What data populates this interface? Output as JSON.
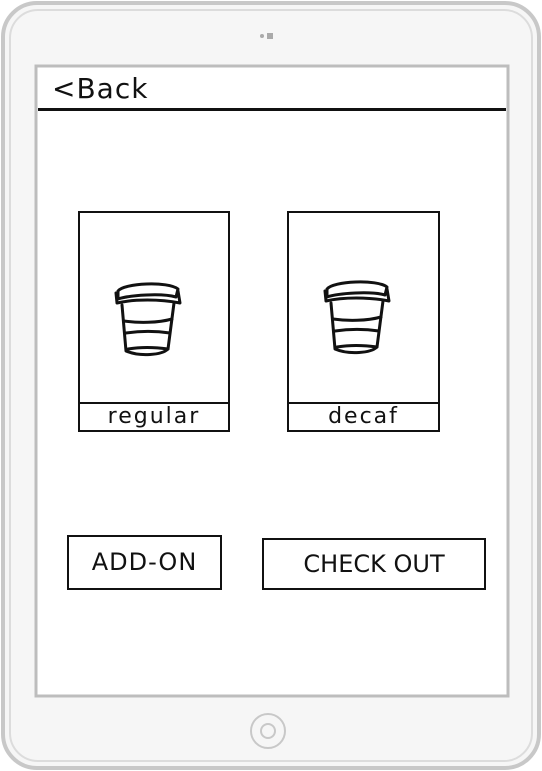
{
  "header": {
    "back_label": "<Back"
  },
  "products": [
    {
      "label": "regular",
      "icon": "coffee-cup-icon"
    },
    {
      "label": "decaf",
      "icon": "coffee-cup-icon"
    }
  ],
  "actions": {
    "addon_label": "ADD-ON",
    "checkout_label": "CHECK OUT"
  },
  "colors": {
    "ink": "#111111",
    "device_frame": "#c8c8c8",
    "device_body": "#f6f6f6"
  }
}
